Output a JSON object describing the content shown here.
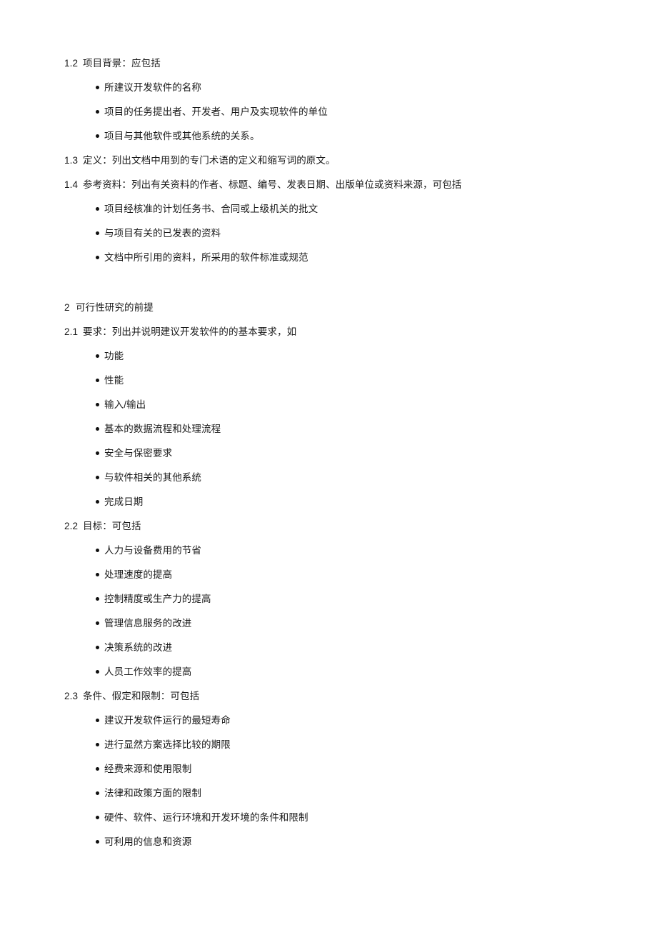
{
  "document": {
    "background_color": "#ffffff",
    "text_color": "#1a1a1a",
    "bullet_color": "#111111",
    "sections": [
      {
        "number": "1.2",
        "title": "项目背景：应包括",
        "bullets": [
          "所建议开发软件的名称",
          "项目的任务提出者、开发者、用户及实现软件的单位",
          "项目与其他软件或其他系统的关系。"
        ]
      },
      {
        "number": "1.3",
        "title": "定义：列出文档中用到的专门术语的定义和缩写词的原文。",
        "bullets": []
      },
      {
        "number": "1.4",
        "title": "参考资料：列出有关资料的作者、标题、编号、发表日期、出版单位或资料来源，可包括",
        "bullets": [
          "项目经核准的计划任务书、合同或上级机关的批文",
          "与项目有关的已发表的资料",
          "文档中所引用的资料，所采用的软件标准或规范"
        ]
      },
      {
        "number": "2",
        "title": "可行性研究的前提",
        "bullets": []
      },
      {
        "number": "2.1",
        "title": "要求：列出并说明建议开发软件的的基本要求，如",
        "bullets": [
          "功能",
          "性能",
          "输入/输出",
          "基本的数据流程和处理流程",
          "安全与保密要求",
          "与软件相关的其他系统",
          "完成日期"
        ]
      },
      {
        "number": "2.2",
        "title": "目标：可包括",
        "bullets": [
          "人力与设备费用的节省",
          "处理速度的提高",
          "控制精度或生产力的提高",
          "管理信息服务的改进",
          "决策系统的改进",
          "人员工作效率的提高"
        ]
      },
      {
        "number": "2.3",
        "title": "条件、假定和限制：可包括",
        "bullets": [
          "建议开发软件运行的最短寿命",
          "进行显然方案选择比较的期限",
          "经费来源和使用限制",
          "法律和政策方面的限制",
          "硬件、软件、运行环境和开发环境的条件和限制",
          "可利用的信息和资源"
        ]
      }
    ]
  }
}
